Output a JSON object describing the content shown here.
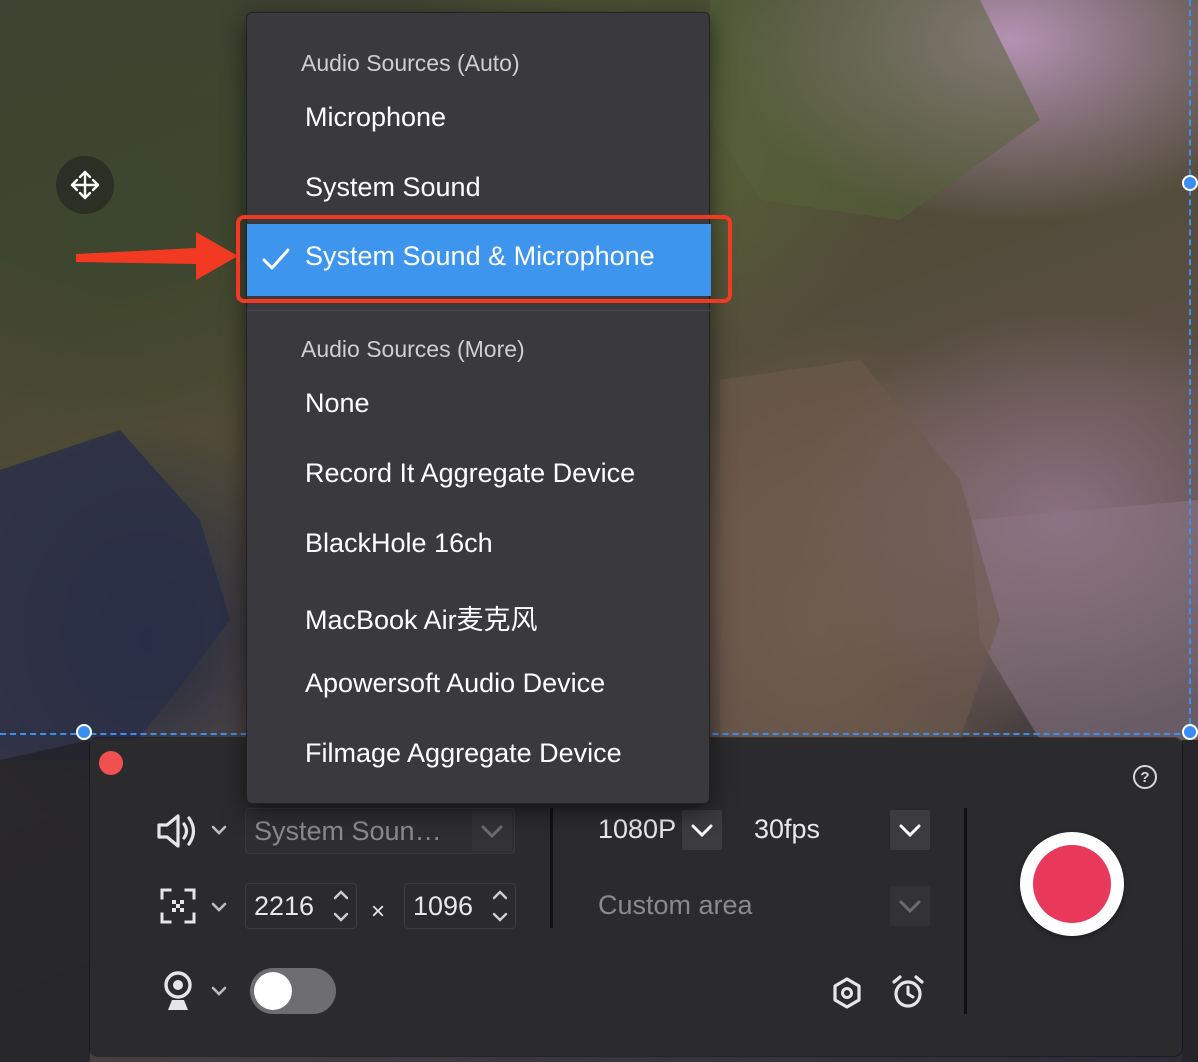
{
  "menu": {
    "header_auto": "Audio Sources (Auto)",
    "items_auto": [
      "Microphone",
      "System Sound"
    ],
    "selected_item": "System Sound & Microphone",
    "header_more": "Audio Sources (More)",
    "items_more": [
      "None",
      "Record It Aggregate Device",
      "BlackHole 16ch",
      "MacBook Air麦克风",
      "Apowersoft Audio Device",
      "Filmage Aggregate Device"
    ]
  },
  "toolbar": {
    "audio_source_value": "System Soun…",
    "width_value": "2216",
    "times_symbol": "×",
    "height_value": "1096",
    "resolution_value": "1080P",
    "fps_value": "30fps",
    "area_value": "Custom area",
    "help_symbol": "?",
    "webcam_enabled": false
  },
  "colors": {
    "accent_selection": "#3d95ee",
    "record_button": "#e8395a",
    "annotation": "#f23a23",
    "close_dot": "#f0504f"
  },
  "icons": {
    "move": "move-arrows-icon",
    "speaker": "speaker-icon",
    "area": "region-select-icon",
    "webcam": "webcam-icon",
    "settings": "hexagon-settings-icon",
    "timer": "alarm-clock-icon",
    "check": "checkmark-icon"
  }
}
